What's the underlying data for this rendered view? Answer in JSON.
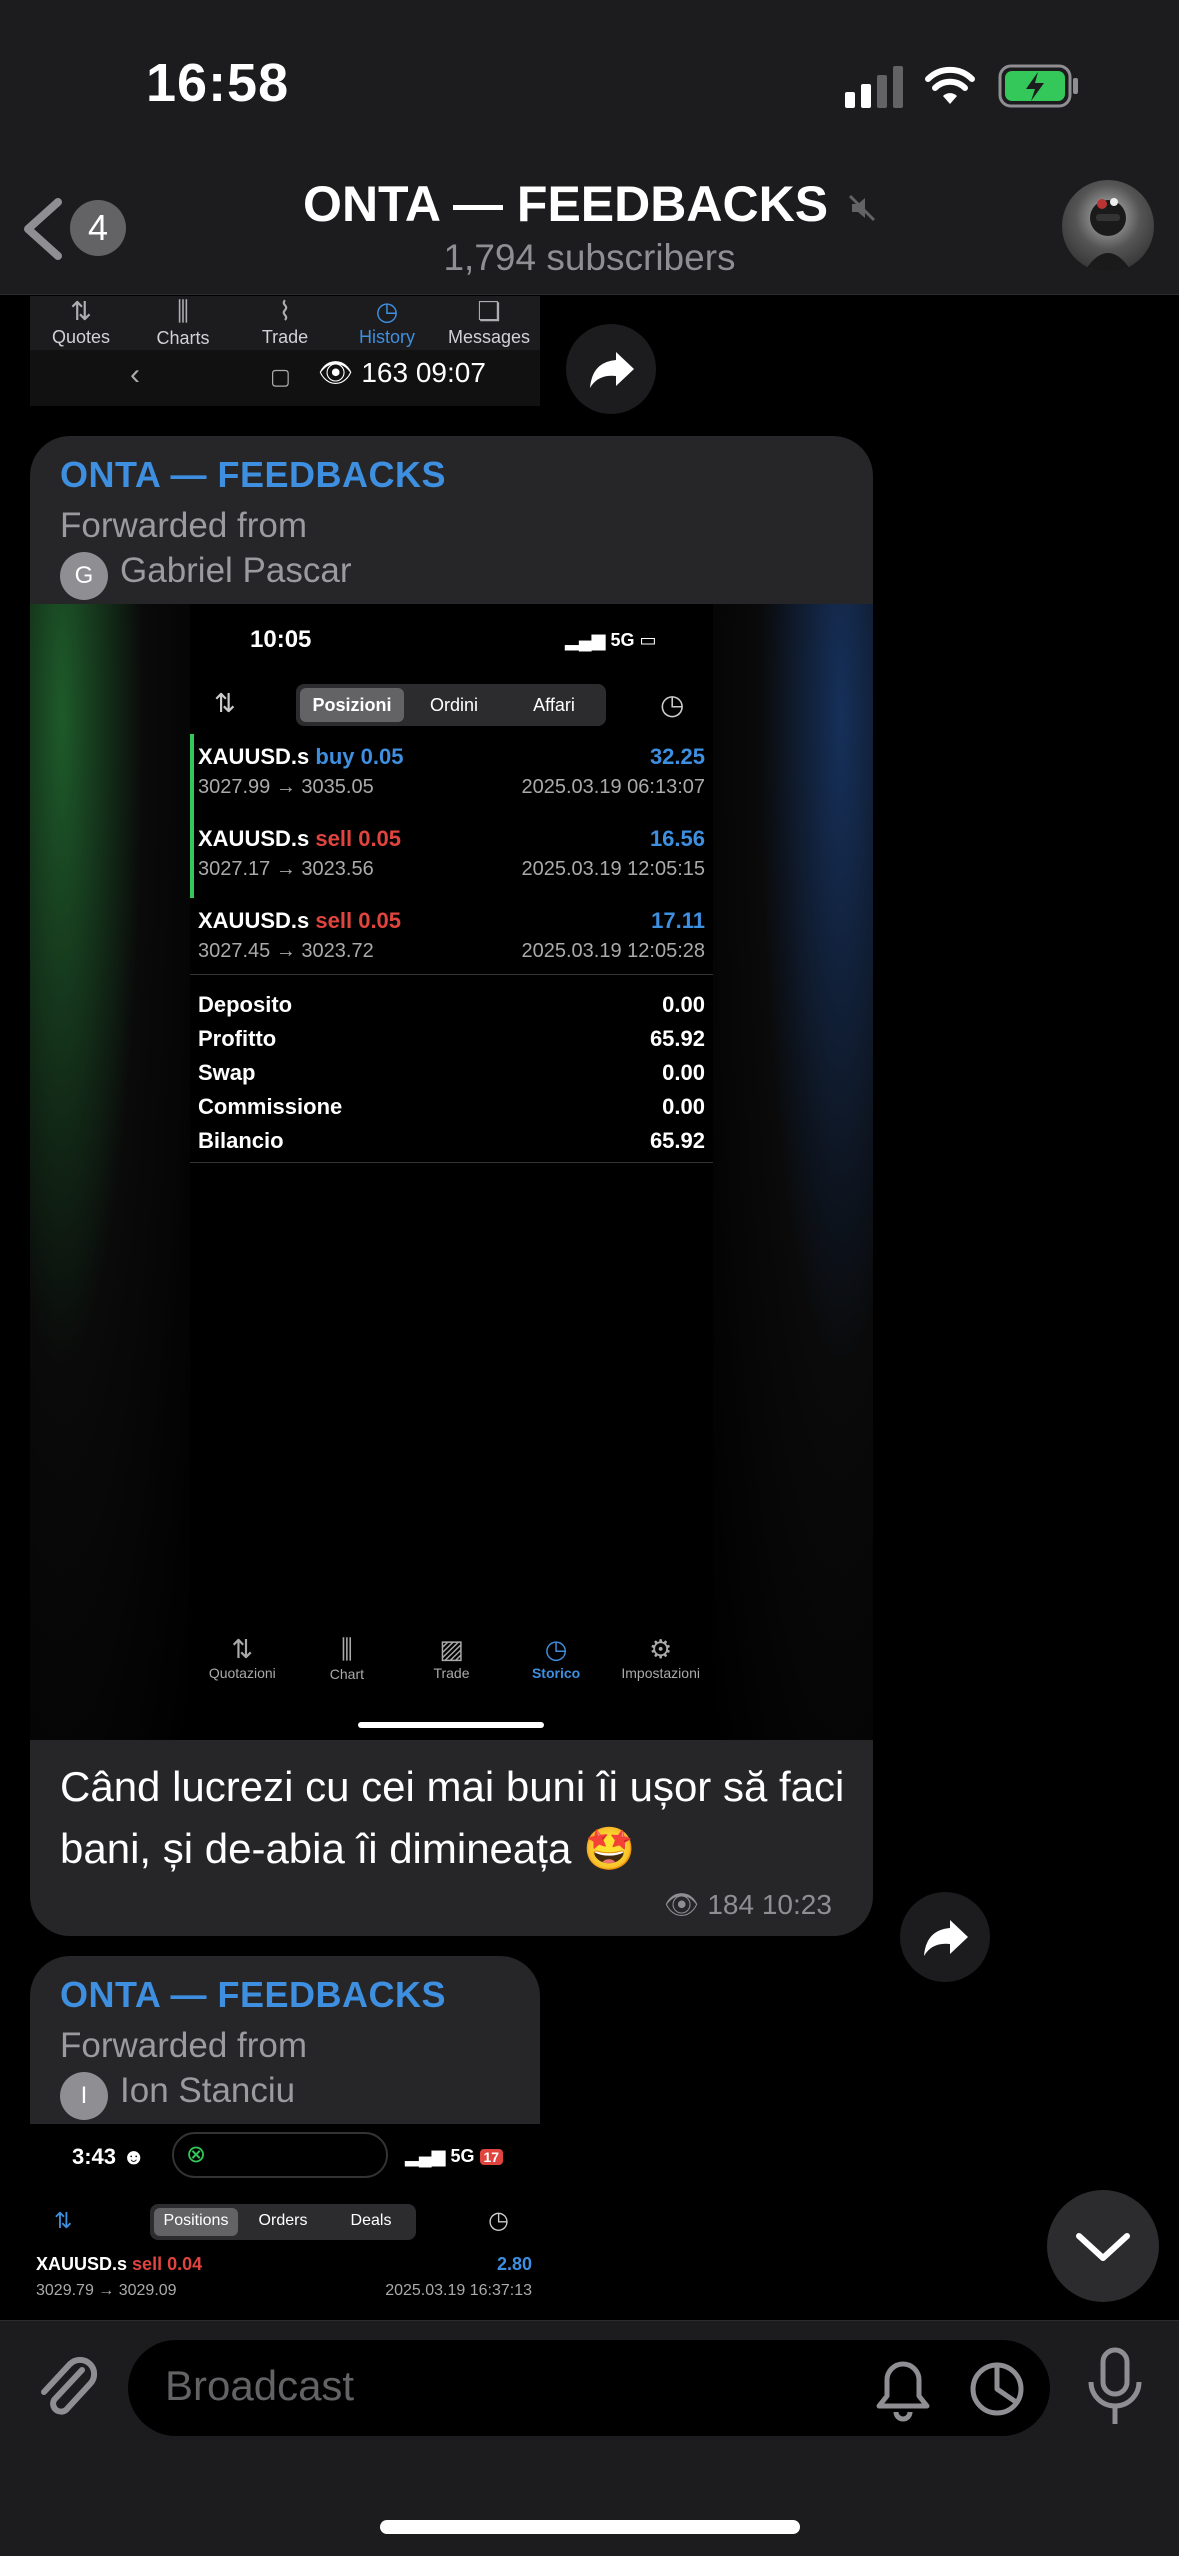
{
  "status": {
    "time": "16:58"
  },
  "header": {
    "back_count": "4",
    "title": "ONTA — FEEDBACKS",
    "subtitle": "1,794 subscribers"
  },
  "top_fragment": {
    "tabs": [
      {
        "icon": "quotes-icon",
        "label": "Quotes"
      },
      {
        "icon": "charts-icon",
        "label": "Charts"
      },
      {
        "icon": "trade-icon",
        "label": "Trade"
      },
      {
        "icon": "history-icon",
        "label": "History",
        "active": true
      },
      {
        "icon": "messages-icon",
        "label": "Messages"
      }
    ],
    "views": "163",
    "time": "09:07"
  },
  "message1": {
    "channel": "ONTA — FEEDBACKS",
    "forwarded_label": "Forwarded from",
    "from_initial": "G",
    "from_name": "Gabriel Pascar",
    "phone": {
      "time": "10:05",
      "network": "5G",
      "tabs": [
        "Posizioni",
        "Ordini",
        "Affari"
      ],
      "trades": [
        {
          "symbol": "XAUUSD.s",
          "side": "buy",
          "lot": "0.05",
          "profit": "32.25",
          "prices": "3027.99 → 3035.05",
          "date": "2025.03.19 06:13:07"
        },
        {
          "symbol": "XAUUSD.s",
          "side": "sell",
          "lot": "0.05",
          "profit": "16.56",
          "prices": "3027.17 → 3023.56",
          "date": "2025.03.19 12:05:15"
        },
        {
          "symbol": "XAUUSD.s",
          "side": "sell",
          "lot": "0.05",
          "profit": "17.11",
          "prices": "3027.45 → 3023.72",
          "date": "2025.03.19 12:05:28"
        }
      ],
      "summary": [
        {
          "label": "Deposito",
          "value": "0.00"
        },
        {
          "label": "Profitto",
          "value": "65.92"
        },
        {
          "label": "Swap",
          "value": "0.00"
        },
        {
          "label": "Commissione",
          "value": "0.00"
        },
        {
          "label": "Bilancio",
          "value": "65.92"
        }
      ],
      "bottom_tabs": [
        "Quotazioni",
        "Chart",
        "Trade",
        "Storico",
        "Impostazioni"
      ]
    },
    "caption": "Când lucrezi cu cei mai buni îi ușor să faci bani, și de-abia îi dimineața 🤩",
    "views": "184",
    "time": "10:23"
  },
  "message2": {
    "channel": "ONTA — FEEDBACKS",
    "forwarded_label": "Forwarded from",
    "from_initial": "I",
    "from_name": "Ion Stanciu",
    "phone": {
      "time": "3:43",
      "network": "5G",
      "battery": "17",
      "tabs": [
        "Positions",
        "Orders",
        "Deals"
      ],
      "trade": {
        "symbol": "XAUUSD.s",
        "side": "sell",
        "lot": "0.04",
        "profit": "2.80",
        "prices": "3029.79 → 3029.09",
        "date": "2025.03.19 16:37:13"
      }
    }
  },
  "composer": {
    "placeholder": "Broadcast"
  },
  "colors": {
    "accent": "#3e8fe0",
    "buy": "#3e8fe0",
    "sell": "#e0443e",
    "background": "#000000",
    "bubble": "#262628"
  }
}
